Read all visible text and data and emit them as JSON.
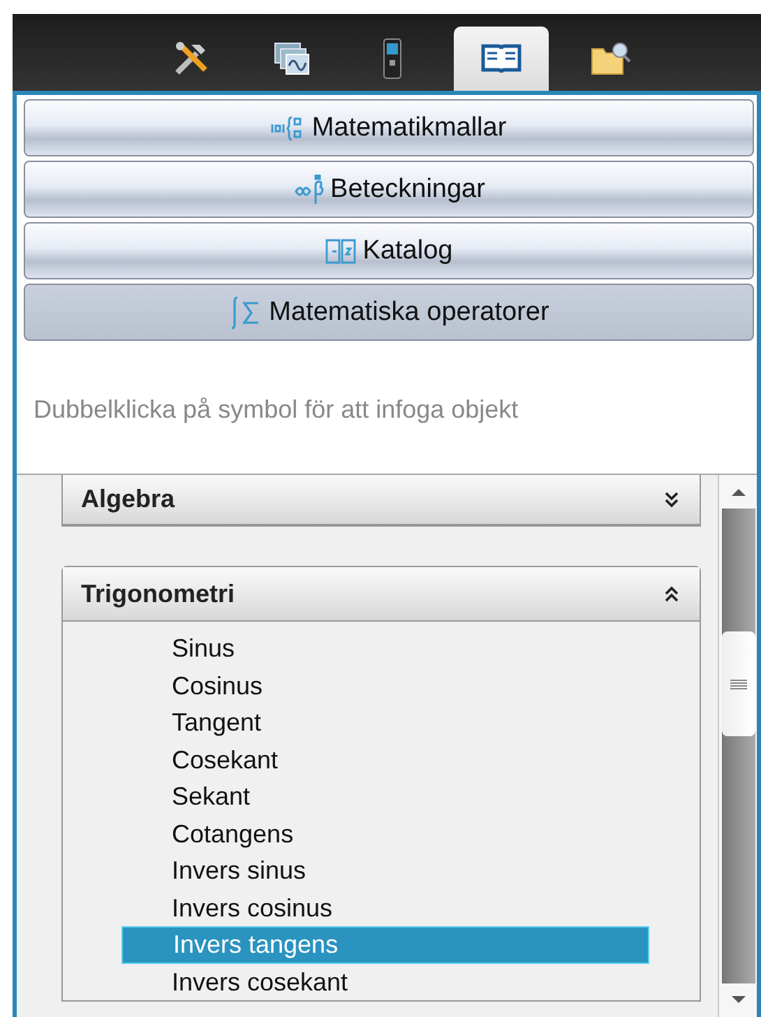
{
  "tabs": [
    {
      "kind": "tools",
      "selected": false
    },
    {
      "kind": "graphs",
      "selected": false
    },
    {
      "kind": "device",
      "selected": false
    },
    {
      "kind": "book",
      "selected": true
    },
    {
      "kind": "folder",
      "selected": false
    }
  ],
  "panels": [
    {
      "kind": "templates",
      "label": "Matematikmallar",
      "selected": false
    },
    {
      "kind": "symbols",
      "label": "Beteckningar",
      "selected": false
    },
    {
      "kind": "catalog",
      "label": "Katalog",
      "selected": false
    },
    {
      "kind": "operators",
      "label": "Matematiska operatorer",
      "selected": true
    }
  ],
  "hint": "Dubbelklicka på symbol för att infoga objekt",
  "sections": [
    {
      "title": "Algebra",
      "expanded": false
    },
    {
      "title": "Trigonometri",
      "expanded": true,
      "items": [
        {
          "label": "Sinus",
          "selected": false
        },
        {
          "label": "Cosinus",
          "selected": false
        },
        {
          "label": "Tangent",
          "selected": false
        },
        {
          "label": "Cosekant",
          "selected": false
        },
        {
          "label": "Sekant",
          "selected": false
        },
        {
          "label": "Cotangens",
          "selected": false
        },
        {
          "label": "Invers sinus",
          "selected": false
        },
        {
          "label": "Invers cosinus",
          "selected": false
        },
        {
          "label": "Invers tangens",
          "selected": true
        },
        {
          "label": "Invers cosekant",
          "selected": false
        }
      ]
    }
  ]
}
